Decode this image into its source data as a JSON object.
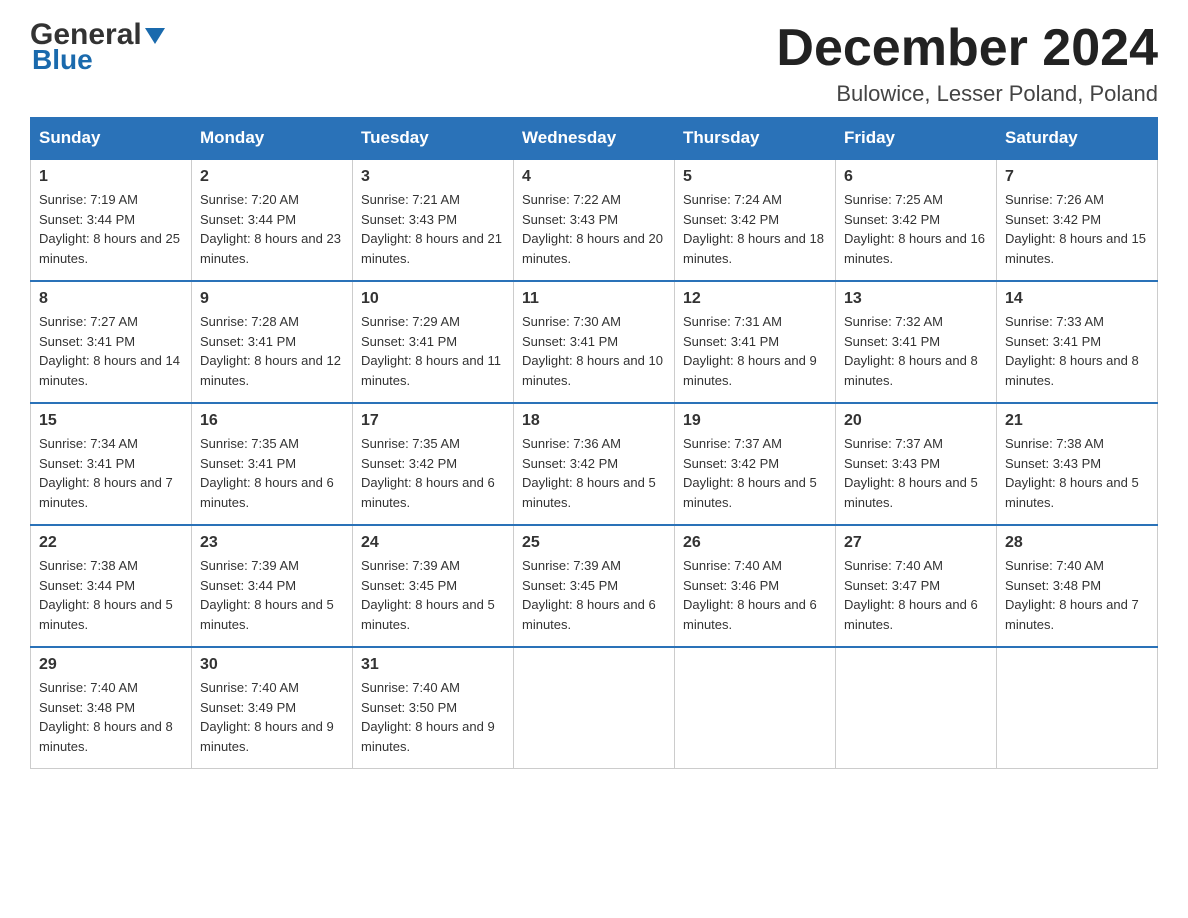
{
  "header": {
    "logo_top": "General",
    "logo_chevron": "▼",
    "logo_bottom": "Blue",
    "month_title": "December 2024",
    "location": "Bulowice, Lesser Poland, Poland"
  },
  "days_of_week": [
    "Sunday",
    "Monday",
    "Tuesday",
    "Wednesday",
    "Thursday",
    "Friday",
    "Saturday"
  ],
  "weeks": [
    [
      {
        "day": "1",
        "sunrise": "Sunrise: 7:19 AM",
        "sunset": "Sunset: 3:44 PM",
        "daylight": "Daylight: 8 hours and 25 minutes."
      },
      {
        "day": "2",
        "sunrise": "Sunrise: 7:20 AM",
        "sunset": "Sunset: 3:44 PM",
        "daylight": "Daylight: 8 hours and 23 minutes."
      },
      {
        "day": "3",
        "sunrise": "Sunrise: 7:21 AM",
        "sunset": "Sunset: 3:43 PM",
        "daylight": "Daylight: 8 hours and 21 minutes."
      },
      {
        "day": "4",
        "sunrise": "Sunrise: 7:22 AM",
        "sunset": "Sunset: 3:43 PM",
        "daylight": "Daylight: 8 hours and 20 minutes."
      },
      {
        "day": "5",
        "sunrise": "Sunrise: 7:24 AM",
        "sunset": "Sunset: 3:42 PM",
        "daylight": "Daylight: 8 hours and 18 minutes."
      },
      {
        "day": "6",
        "sunrise": "Sunrise: 7:25 AM",
        "sunset": "Sunset: 3:42 PM",
        "daylight": "Daylight: 8 hours and 16 minutes."
      },
      {
        "day": "7",
        "sunrise": "Sunrise: 7:26 AM",
        "sunset": "Sunset: 3:42 PM",
        "daylight": "Daylight: 8 hours and 15 minutes."
      }
    ],
    [
      {
        "day": "8",
        "sunrise": "Sunrise: 7:27 AM",
        "sunset": "Sunset: 3:41 PM",
        "daylight": "Daylight: 8 hours and 14 minutes."
      },
      {
        "day": "9",
        "sunrise": "Sunrise: 7:28 AM",
        "sunset": "Sunset: 3:41 PM",
        "daylight": "Daylight: 8 hours and 12 minutes."
      },
      {
        "day": "10",
        "sunrise": "Sunrise: 7:29 AM",
        "sunset": "Sunset: 3:41 PM",
        "daylight": "Daylight: 8 hours and 11 minutes."
      },
      {
        "day": "11",
        "sunrise": "Sunrise: 7:30 AM",
        "sunset": "Sunset: 3:41 PM",
        "daylight": "Daylight: 8 hours and 10 minutes."
      },
      {
        "day": "12",
        "sunrise": "Sunrise: 7:31 AM",
        "sunset": "Sunset: 3:41 PM",
        "daylight": "Daylight: 8 hours and 9 minutes."
      },
      {
        "day": "13",
        "sunrise": "Sunrise: 7:32 AM",
        "sunset": "Sunset: 3:41 PM",
        "daylight": "Daylight: 8 hours and 8 minutes."
      },
      {
        "day": "14",
        "sunrise": "Sunrise: 7:33 AM",
        "sunset": "Sunset: 3:41 PM",
        "daylight": "Daylight: 8 hours and 8 minutes."
      }
    ],
    [
      {
        "day": "15",
        "sunrise": "Sunrise: 7:34 AM",
        "sunset": "Sunset: 3:41 PM",
        "daylight": "Daylight: 8 hours and 7 minutes."
      },
      {
        "day": "16",
        "sunrise": "Sunrise: 7:35 AM",
        "sunset": "Sunset: 3:41 PM",
        "daylight": "Daylight: 8 hours and 6 minutes."
      },
      {
        "day": "17",
        "sunrise": "Sunrise: 7:35 AM",
        "sunset": "Sunset: 3:42 PM",
        "daylight": "Daylight: 8 hours and 6 minutes."
      },
      {
        "day": "18",
        "sunrise": "Sunrise: 7:36 AM",
        "sunset": "Sunset: 3:42 PM",
        "daylight": "Daylight: 8 hours and 5 minutes."
      },
      {
        "day": "19",
        "sunrise": "Sunrise: 7:37 AM",
        "sunset": "Sunset: 3:42 PM",
        "daylight": "Daylight: 8 hours and 5 minutes."
      },
      {
        "day": "20",
        "sunrise": "Sunrise: 7:37 AM",
        "sunset": "Sunset: 3:43 PM",
        "daylight": "Daylight: 8 hours and 5 minutes."
      },
      {
        "day": "21",
        "sunrise": "Sunrise: 7:38 AM",
        "sunset": "Sunset: 3:43 PM",
        "daylight": "Daylight: 8 hours and 5 minutes."
      }
    ],
    [
      {
        "day": "22",
        "sunrise": "Sunrise: 7:38 AM",
        "sunset": "Sunset: 3:44 PM",
        "daylight": "Daylight: 8 hours and 5 minutes."
      },
      {
        "day": "23",
        "sunrise": "Sunrise: 7:39 AM",
        "sunset": "Sunset: 3:44 PM",
        "daylight": "Daylight: 8 hours and 5 minutes."
      },
      {
        "day": "24",
        "sunrise": "Sunrise: 7:39 AM",
        "sunset": "Sunset: 3:45 PM",
        "daylight": "Daylight: 8 hours and 5 minutes."
      },
      {
        "day": "25",
        "sunrise": "Sunrise: 7:39 AM",
        "sunset": "Sunset: 3:45 PM",
        "daylight": "Daylight: 8 hours and 6 minutes."
      },
      {
        "day": "26",
        "sunrise": "Sunrise: 7:40 AM",
        "sunset": "Sunset: 3:46 PM",
        "daylight": "Daylight: 8 hours and 6 minutes."
      },
      {
        "day": "27",
        "sunrise": "Sunrise: 7:40 AM",
        "sunset": "Sunset: 3:47 PM",
        "daylight": "Daylight: 8 hours and 6 minutes."
      },
      {
        "day": "28",
        "sunrise": "Sunrise: 7:40 AM",
        "sunset": "Sunset: 3:48 PM",
        "daylight": "Daylight: 8 hours and 7 minutes."
      }
    ],
    [
      {
        "day": "29",
        "sunrise": "Sunrise: 7:40 AM",
        "sunset": "Sunset: 3:48 PM",
        "daylight": "Daylight: 8 hours and 8 minutes."
      },
      {
        "day": "30",
        "sunrise": "Sunrise: 7:40 AM",
        "sunset": "Sunset: 3:49 PM",
        "daylight": "Daylight: 8 hours and 9 minutes."
      },
      {
        "day": "31",
        "sunrise": "Sunrise: 7:40 AM",
        "sunset": "Sunset: 3:50 PM",
        "daylight": "Daylight: 8 hours and 9 minutes."
      },
      {
        "day": "",
        "sunrise": "",
        "sunset": "",
        "daylight": ""
      },
      {
        "day": "",
        "sunrise": "",
        "sunset": "",
        "daylight": ""
      },
      {
        "day": "",
        "sunrise": "",
        "sunset": "",
        "daylight": ""
      },
      {
        "day": "",
        "sunrise": "",
        "sunset": "",
        "daylight": ""
      }
    ]
  ]
}
